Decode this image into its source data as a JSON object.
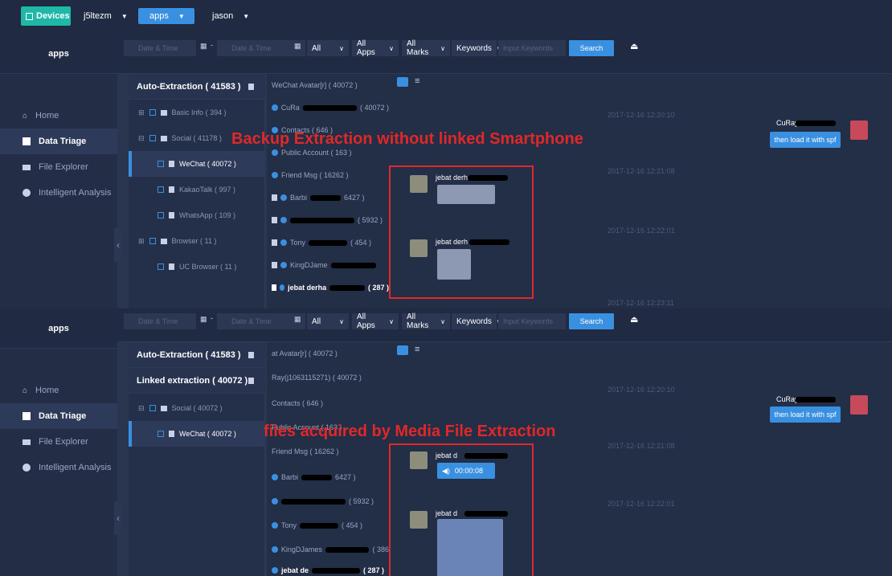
{
  "topbar": {
    "devices_label": "Devices",
    "device_name": "j5ltezm",
    "app_selector": "apps",
    "user_selector": "jason"
  },
  "colors": {
    "accent": "#3a90e0",
    "annotation": "#e02828",
    "devices": "#1fb7a8"
  },
  "filter": {
    "date_placeholder": "Date & Time",
    "dash": "-",
    "all_label": "All",
    "all_apps_label": "All Apps",
    "all_marks_label": "All Marks",
    "keywords_label": "Keywords",
    "keywords_placeholder": "Input Keywords",
    "search_label": "Search"
  },
  "nav": {
    "title": "apps",
    "items": [
      {
        "label": "Home",
        "icon": "home-icon"
      },
      {
        "label": "Data Triage",
        "icon": "triage-icon"
      },
      {
        "label": "File Explorer",
        "icon": "folder-icon"
      },
      {
        "label": "Intelligent Analysis",
        "icon": "analysis-icon"
      }
    ]
  },
  "panel1": {
    "annotation": "Backup Extraction without linked Smartphone",
    "tree": {
      "header": "Auto-Extraction ( 41583 )",
      "nodes": [
        {
          "label": "Basic Info ( 394 )"
        },
        {
          "label": "Social ( 41178 )"
        },
        {
          "label": "WeChat ( 40072 )"
        },
        {
          "label": "KakaoTalk ( 997 )"
        },
        {
          "label": "WhatsApp ( 109 )"
        },
        {
          "label": "Browser ( 11 )"
        },
        {
          "label": "UC Browser ( 11 )"
        }
      ]
    },
    "contacts": [
      {
        "label": "WeChat Avatar[r] ( 40072 )"
      },
      {
        "label": "CuRa",
        "suffix": "( 40072 )"
      },
      {
        "label": "Contacts ( 646 )"
      },
      {
        "label": "Public Account ( 163 )"
      },
      {
        "label": "Friend Msg ( 16262 )"
      },
      {
        "label": "Barbi",
        "suffix": "6427 )"
      },
      {
        "label": "",
        "suffix": "( 5932 )"
      },
      {
        "label": "Tony",
        "suffix": "( 454 )"
      },
      {
        "label": "KingDJame",
        "suffix": ""
      },
      {
        "label": "jebat derha",
        "suffix": "( 287 )"
      }
    ],
    "timestamps": [
      "2017-12-16 12:20:10",
      "2017-12-16 12:21:08",
      "2017-12-16 12:22:01",
      "2017-12-16 12:23:11"
    ],
    "messages": [
      {
        "sender": "jebat derh"
      },
      {
        "sender": "jebat derh"
      }
    ],
    "right_sender": "CuRay",
    "right_text": "then load it with spf"
  },
  "panel2": {
    "annotation": "files acquired by Media File Extraction",
    "tree": {
      "header1": "Auto-Extraction ( 41583 )",
      "header2": "Linked extraction ( 40072 )",
      "nodes": [
        {
          "label": "Social ( 40072 )"
        },
        {
          "label": "WeChat ( 40072 )"
        }
      ]
    },
    "contacts": [
      {
        "label": "at Avatar[r] ( 40072 )"
      },
      {
        "label": "Ray(j1063115271) ( 40072 )"
      },
      {
        "label": "Contacts ( 646 )"
      },
      {
        "label": "Public Account ( 163 )"
      },
      {
        "label": "Friend Msg ( 16262 )"
      },
      {
        "label": "Barbi",
        "suffix": "6427 )"
      },
      {
        "label": "",
        "suffix": "( 5932 )"
      },
      {
        "label": "Tony",
        "suffix": "( 454 )"
      },
      {
        "label": "KingDJames",
        "suffix": "( 386"
      },
      {
        "label": "jebat de",
        "suffix": "( 287 )"
      }
    ],
    "timestamps": [
      "2017-12-16 12:20:10",
      "2017-12-16 12:21:08",
      "2017-12-16 12:22:01"
    ],
    "messages": [
      {
        "sender": "jebat d",
        "voice": "00:00:08"
      },
      {
        "sender": "jebat d"
      }
    ],
    "right_sender": "CuRay",
    "right_text": "then load it with spf"
  }
}
